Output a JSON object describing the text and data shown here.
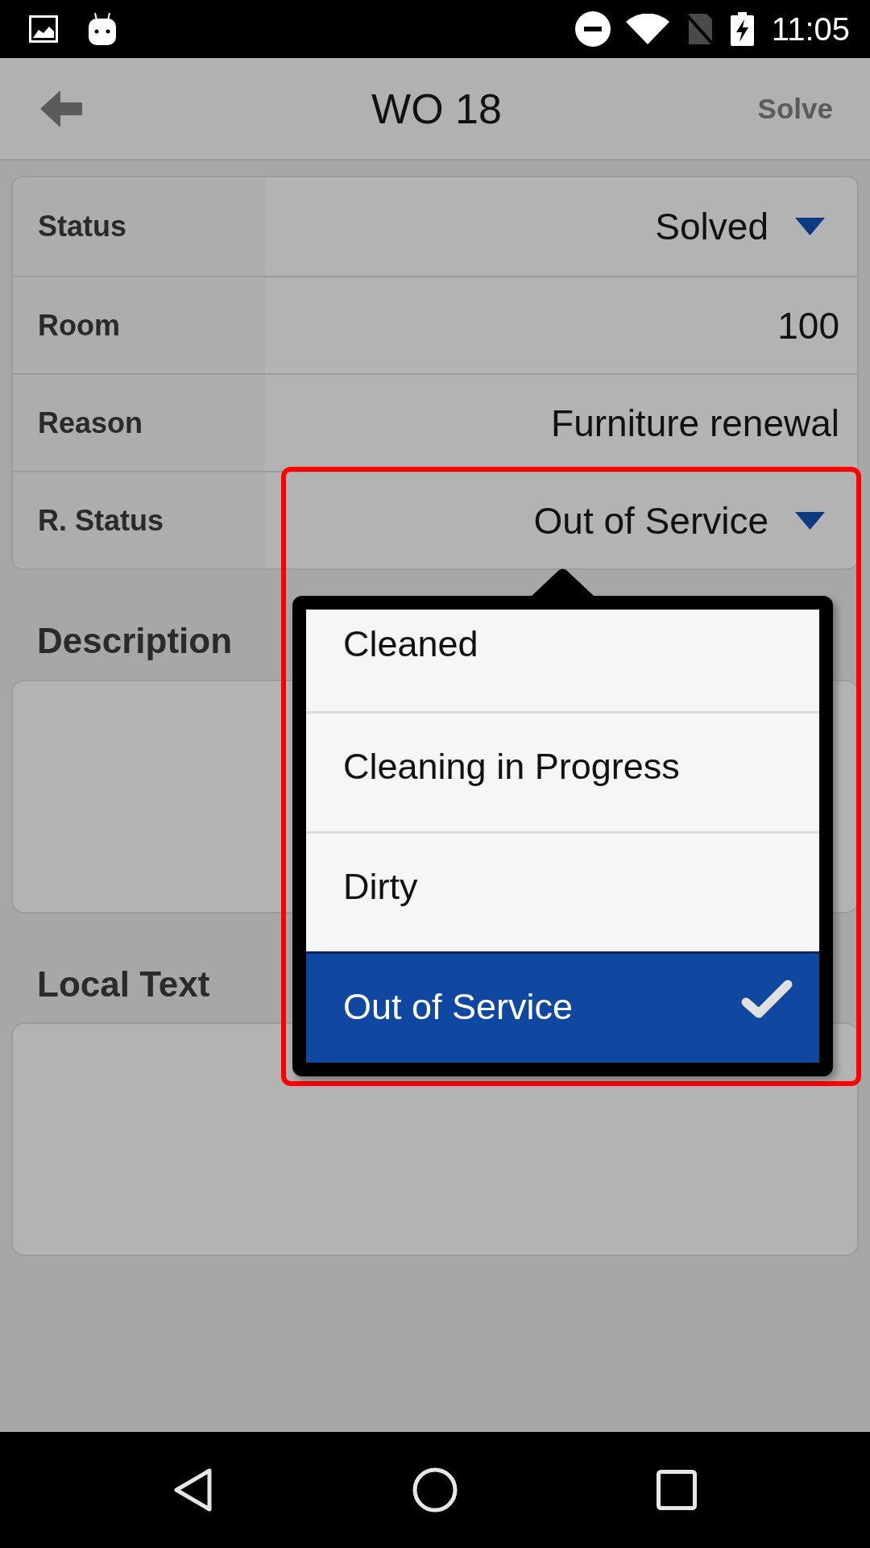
{
  "status_bar": {
    "time": "11:05"
  },
  "header": {
    "title": "WO 18",
    "action": "Solve"
  },
  "fields": [
    {
      "label": "Status",
      "value": "Solved",
      "kind": "dropdown"
    },
    {
      "label": "Room",
      "value": "100",
      "kind": "text"
    },
    {
      "label": "Reason",
      "value": "Furniture renewal",
      "kind": "text"
    },
    {
      "label": "R. Status",
      "value": "Out of Service",
      "kind": "dropdown"
    }
  ],
  "sections": [
    {
      "label": "Description"
    },
    {
      "label": "Local Text"
    }
  ],
  "dropdown_menu": {
    "options": [
      {
        "label": "Cleaned",
        "selected": false
      },
      {
        "label": "Cleaning in Progress",
        "selected": false
      },
      {
        "label": "Dirty",
        "selected": false
      },
      {
        "label": "Out of Service",
        "selected": true
      }
    ]
  },
  "highlight_outline": true
}
